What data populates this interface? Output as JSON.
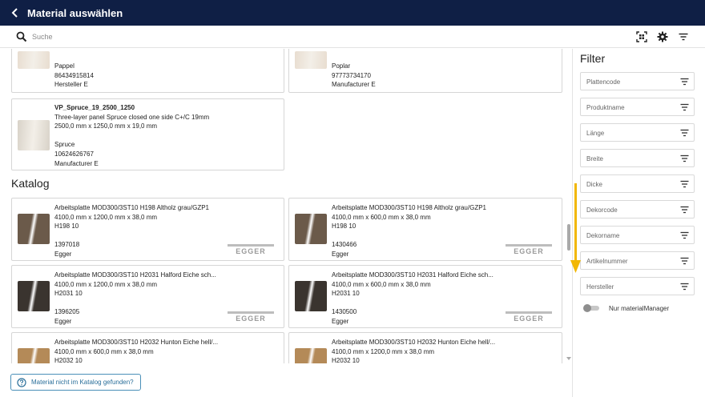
{
  "header": {
    "title": "Material auswählen",
    "back_icon": "chevron-left-icon"
  },
  "search": {
    "placeholder": "Suche",
    "value": ""
  },
  "toolbar": {
    "icons": [
      "scan-icon",
      "gear-icon",
      "filter-icon"
    ]
  },
  "top_results": [
    {
      "name": "Pappel",
      "code": "86434915814",
      "manufacturer": "Hersteller E",
      "thumb_color": "#e8ddd0"
    },
    {
      "name": "Poplar",
      "code": "97773734170",
      "manufacturer": "Manufacturer E",
      "thumb_color": "#e8ddd0"
    }
  ],
  "selected_result": {
    "title": "VP_Spruce_19_2500_1250",
    "description": "Three-layer panel Spruce closed one side C+/C 19mm",
    "dimensions": "2500,0 mm x 1250,0 mm x 19,0 mm",
    "name": "Spruce",
    "code": "10624626767",
    "manufacturer": "Manufacturer E",
    "thumb_color": "#d8d2c8"
  },
  "catalog": {
    "title": "Katalog",
    "items": [
      {
        "title": "Arbeitsplatte MOD300/3ST10 H198 Altholz grau/GZP1",
        "dimensions": "4100,0 mm x 1200,0 mm x 38,0 mm",
        "decor": "H198 10",
        "code": "1397018",
        "manufacturer": "Egger",
        "thumb_color": "#6b5a4a"
      },
      {
        "title": "Arbeitsplatte MOD300/3ST10 H198 Altholz grau/GZP1",
        "dimensions": "4100,0 mm x 600,0 mm x 38,0 mm",
        "decor": "H198 10",
        "code": "1430466",
        "manufacturer": "Egger",
        "thumb_color": "#6b5a4a"
      },
      {
        "title": "Arbeitsplatte MOD300/3ST10 H2031 Halford Eiche sch...",
        "dimensions": "4100,0 mm x 1200,0 mm x 38,0 mm",
        "decor": "H2031 10",
        "code": "1396205",
        "manufacturer": "Egger",
        "thumb_color": "#3a342f"
      },
      {
        "title": "Arbeitsplatte MOD300/3ST10 H2031 Halford Eiche sch...",
        "dimensions": "4100,0 mm x 600,0 mm x 38,0 mm",
        "decor": "H2031 10",
        "code": "1430500",
        "manufacturer": "Egger",
        "thumb_color": "#3a342f"
      },
      {
        "title": "Arbeitsplatte MOD300/3ST10 H2032 Hunton Eiche hell/...",
        "dimensions": "4100,0 mm x 600,0 mm x 38,0 mm",
        "decor": "H2032 10",
        "code": "",
        "manufacturer": "",
        "thumb_color": "#b48a58"
      },
      {
        "title": "Arbeitsplatte MOD300/3ST10 H2032 Hunton Eiche hell/...",
        "dimensions": "4100,0 mm x 1200,0 mm x 38,0 mm",
        "decor": "H2032 10",
        "code": "",
        "manufacturer": "",
        "thumb_color": "#b48a58"
      }
    ]
  },
  "footer": {
    "not_found_label": "Material nicht im Katalog gefunden?"
  },
  "filter": {
    "title": "Filter",
    "fields": [
      "Plattencode",
      "Produktname",
      "Länge",
      "Breite",
      "Dicke",
      "Dekorcode",
      "Dekorname",
      "Artikelnummer",
      "Hersteller"
    ],
    "toggle_label": "Nur materialManager",
    "toggle_on": false
  },
  "colors": {
    "header_bg": "#0f1f45",
    "accent": "#2a6f9a",
    "annotation_arrow": "#f2b705"
  }
}
